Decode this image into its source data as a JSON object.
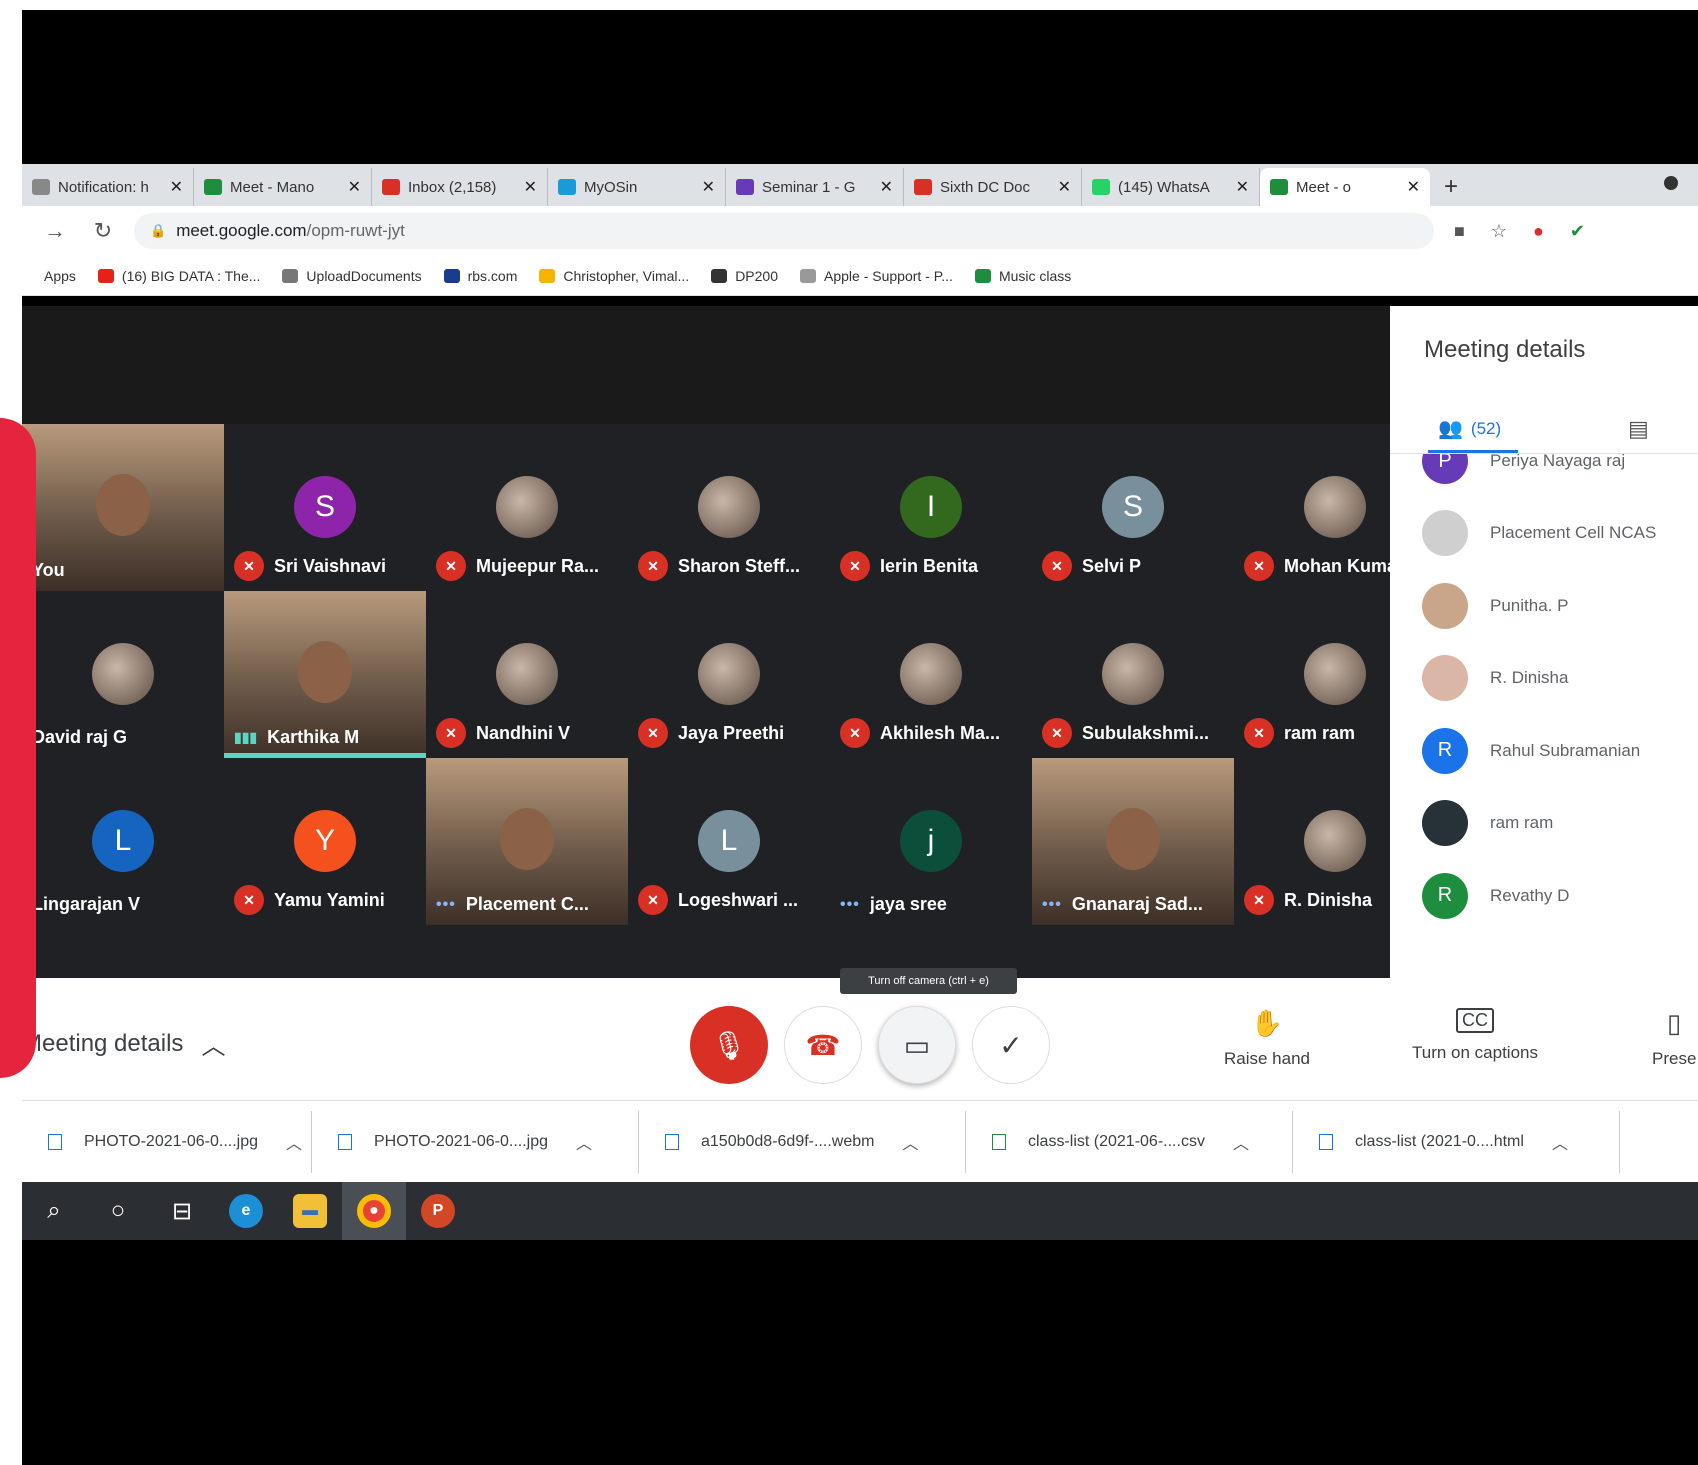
{
  "colors": {
    "accent": "#1a73e8",
    "mic_muted": "#d93025",
    "speaking": "#5bd6c3",
    "highlight": "#e4253d"
  },
  "tabs": [
    {
      "label": "Notification: h",
      "icon": "bell-icon",
      "color": "#888"
    },
    {
      "label": "Meet - Mano",
      "icon": "meet-icon",
      "color": "#1e8e3e"
    },
    {
      "label": "Inbox (2,158)",
      "icon": "gmail-icon",
      "color": "#d93025"
    },
    {
      "label": "MyOSin",
      "icon": "myosin-icon",
      "color": "#1a9ad6"
    },
    {
      "label": "Seminar 1 - G",
      "icon": "forms-icon",
      "color": "#673ab7"
    },
    {
      "label": "Sixth DC Doc",
      "icon": "gmail-icon",
      "color": "#d93025"
    },
    {
      "label": "(145) WhatsA",
      "icon": "whatsapp-icon",
      "color": "#25d366"
    },
    {
      "label": "Meet - o",
      "icon": "meet-icon",
      "color": "#1e8e3e"
    }
  ],
  "address": {
    "host": "meet.google.com",
    "path": "/opm-ruwt-jyt"
  },
  "bookmarks": [
    {
      "label": "Apps",
      "color": ""
    },
    {
      "label": "(16) BIG DATA : The...",
      "color": "#e62117"
    },
    {
      "label": "UploadDocuments",
      "color": "#777"
    },
    {
      "label": "rbs.com",
      "color": "#1a3c8f"
    },
    {
      "label": "Christopher, Vimal...",
      "color": "#f4b400"
    },
    {
      "label": "DP200",
      "color": "#333"
    },
    {
      "label": "Apple - Support - P...",
      "color": "#999"
    },
    {
      "label": "Music class",
      "color": "#1e8e3e"
    }
  ],
  "participants": [
    {
      "name": "You",
      "type": "video",
      "status": "none"
    },
    {
      "name": "Sri Vaishnavi",
      "type": "letter",
      "letter": "S",
      "bg": "#8e24aa",
      "status": "muted"
    },
    {
      "name": "Mujeepur Ra...",
      "type": "photo",
      "status": "muted"
    },
    {
      "name": "Sharon Steff...",
      "type": "photo",
      "status": "muted"
    },
    {
      "name": "Ierin Benita",
      "type": "letter",
      "letter": "I",
      "bg": "#33691e",
      "status": "muted"
    },
    {
      "name": "Selvi P",
      "type": "letter",
      "letter": "S",
      "bg": "#78909c",
      "status": "muted"
    },
    {
      "name": "Mohan Kumar",
      "type": "photo",
      "status": "muted"
    },
    {
      "name": "David raj G",
      "type": "photo",
      "status": "none"
    },
    {
      "name": "Karthika M",
      "type": "video",
      "status": "speaking"
    },
    {
      "name": "Nandhini V",
      "type": "photo",
      "status": "muted"
    },
    {
      "name": "Jaya Preethi",
      "type": "photo",
      "status": "muted"
    },
    {
      "name": "Akhilesh Ma...",
      "type": "photo",
      "status": "muted"
    },
    {
      "name": "Subulakshmi...",
      "type": "photo",
      "status": "muted"
    },
    {
      "name": "ram ram",
      "type": "photo",
      "status": "muted"
    },
    {
      "name": "Lingarajan V",
      "type": "letter",
      "letter": "L",
      "bg": "#1565c0",
      "status": "none"
    },
    {
      "name": "Yamu Yamini",
      "type": "letter",
      "letter": "Y",
      "bg": "#f4511e",
      "status": "muted"
    },
    {
      "name": "Placement C...",
      "type": "video",
      "status": "dots"
    },
    {
      "name": "Logeshwari ...",
      "type": "letter",
      "letter": "L",
      "bg": "#78909c",
      "status": "muted"
    },
    {
      "name": "jaya sree",
      "type": "letter",
      "letter": "j",
      "bg": "#0b4f3a",
      "status": "dots"
    },
    {
      "name": "Gnanaraj Sad...",
      "type": "video",
      "status": "dots"
    },
    {
      "name": "R. Dinisha",
      "type": "photo",
      "status": "muted"
    }
  ],
  "panel": {
    "title": "Meeting details",
    "people_count": "(52)",
    "people": [
      {
        "name": "Periya Nayaga raj",
        "letter": "P",
        "bg": "#673ab7",
        "partial": true
      },
      {
        "name": "Placement Cell NCAS",
        "letter": "",
        "bg": "#cfcfcf"
      },
      {
        "name": "Punitha. P",
        "letter": "",
        "bg": "#c9a58a"
      },
      {
        "name": "R. Dinisha",
        "letter": "",
        "bg": "#d9b6a6"
      },
      {
        "name": "Rahul Subramanian",
        "letter": "R",
        "bg": "#1a73e8"
      },
      {
        "name": "ram ram",
        "letter": "",
        "bg": "#263238"
      },
      {
        "name": "Revathy D",
        "letter": "R",
        "bg": "#1e8e3e"
      }
    ]
  },
  "tooltip": "Turn off camera (ctrl + e)",
  "controls": {
    "meeting_details": "Meeting details",
    "raise_hand": "Raise hand",
    "captions": "Turn on captions",
    "present": "Prese"
  },
  "downloads": [
    {
      "name": "PHOTO-2021-06-0....jpg"
    },
    {
      "name": "PHOTO-2021-06-0....jpg"
    },
    {
      "name": "a150b0d8-6d9f-....webm"
    },
    {
      "name": "class-list (2021-06-....csv"
    },
    {
      "name": "class-list (2021-0....html"
    }
  ]
}
